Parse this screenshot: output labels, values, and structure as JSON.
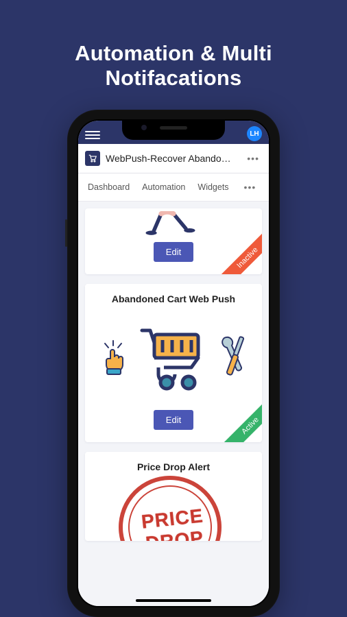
{
  "page": {
    "title": "Automation & Multi Notifacations"
  },
  "topbar": {
    "avatar_initials": "LH"
  },
  "app": {
    "title": "WebPush-Recover Abando…"
  },
  "tabs": {
    "items": [
      {
        "label": "Dashboard"
      },
      {
        "label": "Automation"
      },
      {
        "label": "Widgets"
      }
    ]
  },
  "cards": {
    "welcome": {
      "edit_label": "Edit",
      "status": "Inactive"
    },
    "abandoned": {
      "title": "Abandoned Cart Web Push",
      "edit_label": "Edit",
      "status": "Active"
    },
    "pricedrop": {
      "title": "Price Drop Alert",
      "stamp_text": "PRICE DROP"
    }
  }
}
